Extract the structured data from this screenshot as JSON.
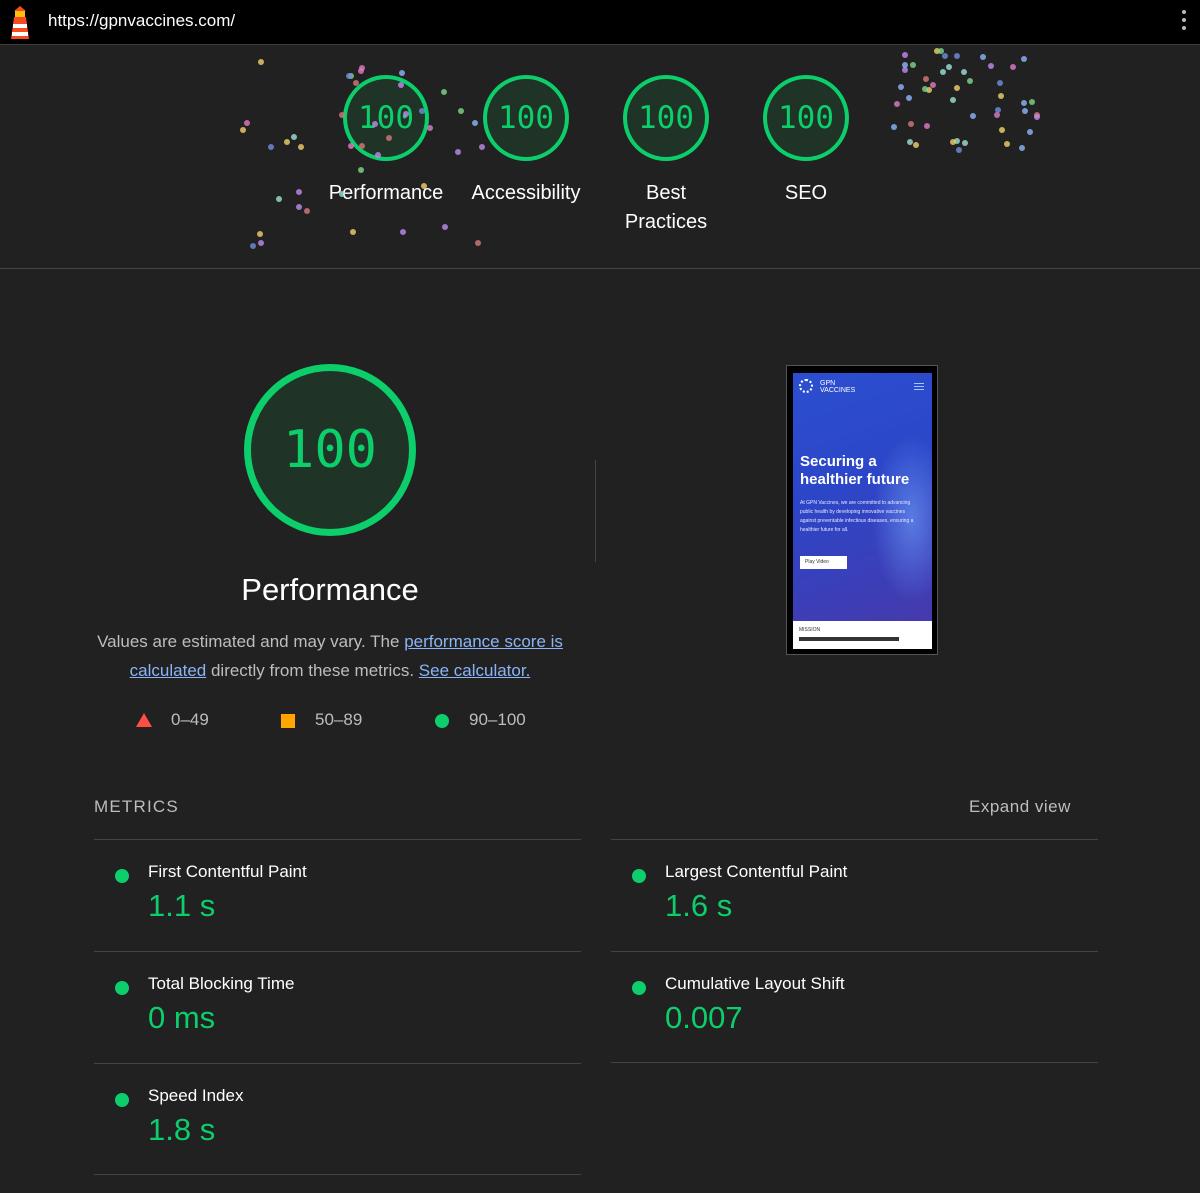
{
  "topbar": {
    "url": "https://gpnvaccines.com/"
  },
  "categories": [
    {
      "label": "Performance",
      "score": "100"
    },
    {
      "label": "Accessibility",
      "score": "100"
    },
    {
      "label": "Best Practices",
      "score": "100"
    },
    {
      "label": "SEO",
      "score": "100"
    }
  ],
  "performance": {
    "score": "100",
    "title": "Performance",
    "desc_prefix": "Values are estimated and may vary. The ",
    "desc_link1": "performance score is calculated",
    "desc_middle": " directly from these metrics. ",
    "desc_link2": "See calculator."
  },
  "legend": [
    {
      "label": "0–49",
      "color": "#ff4e42",
      "shape": "triangle"
    },
    {
      "label": "50–89",
      "color": "#ffa400",
      "shape": "square"
    },
    {
      "label": "90–100",
      "color": "#0cce6b",
      "shape": "circle"
    }
  ],
  "screenshot": {
    "brand_line1": "GPN",
    "brand_line2": "VACCINES",
    "headline": "Securing a healthier future",
    "body": "At GPN Vaccines, we are committed to advancing public health by developing innovative vaccines against preventable infectious diseases, ensuring a healthier future for all.",
    "button": "Play Video",
    "section": "MISSION"
  },
  "metrics_section": {
    "title": "METRICS",
    "expand": "Expand view"
  },
  "metrics": [
    {
      "title": "First Contentful Paint",
      "value": "1.1 s"
    },
    {
      "title": "Largest Contentful Paint",
      "value": "1.6 s"
    },
    {
      "title": "Total Blocking Time",
      "value": "0 ms"
    },
    {
      "title": "Cumulative Layout Shift",
      "value": "0.007"
    },
    {
      "title": "Speed Index",
      "value": "1.8 s"
    }
  ],
  "colors": {
    "pass": "#0cce6b",
    "average": "#ffa400",
    "fail": "#ff4e42",
    "link": "#8ab4f8"
  }
}
